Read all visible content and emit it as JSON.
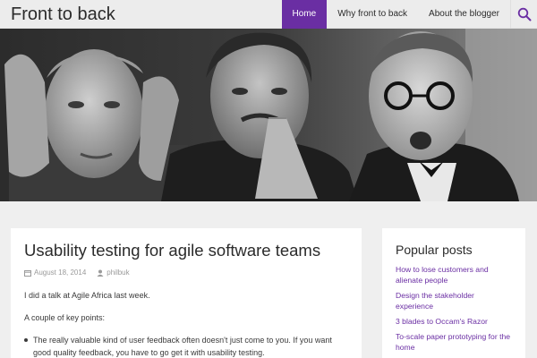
{
  "header": {
    "site_title": "Front to back",
    "nav": [
      {
        "label": "Home",
        "active": true
      },
      {
        "label": "Why front to back",
        "active": false
      },
      {
        "label": "About the blogger",
        "active": false
      }
    ],
    "search_icon": "search-icon"
  },
  "hero": {
    "image": "black-and-white photo of three men in an audience reacting with shock"
  },
  "article": {
    "title": "Usability testing for agile software teams",
    "date": "August 18, 2014",
    "author": "philbuk",
    "paragraphs": [
      "I did a talk at Agile Africa last week.",
      "A couple of key points:"
    ],
    "bullets": [
      "The really valuable kind of user feedback often doesn't just come to you. If you want good quality feedback, you have to go get it with usability testing."
    ]
  },
  "sidebar": {
    "title": "Popular posts",
    "posts": [
      "How to lose customers and alienate people",
      "Design the stakeholder experience",
      "3 blades to Occam's Razor",
      "To-scale paper prototyping for the home"
    ]
  },
  "colors": {
    "accent": "#6a2ea3",
    "header_bg": "#ececec",
    "page_bg": "#efefef",
    "card_bg": "#ffffff",
    "meta_text": "#9a9a9a"
  }
}
